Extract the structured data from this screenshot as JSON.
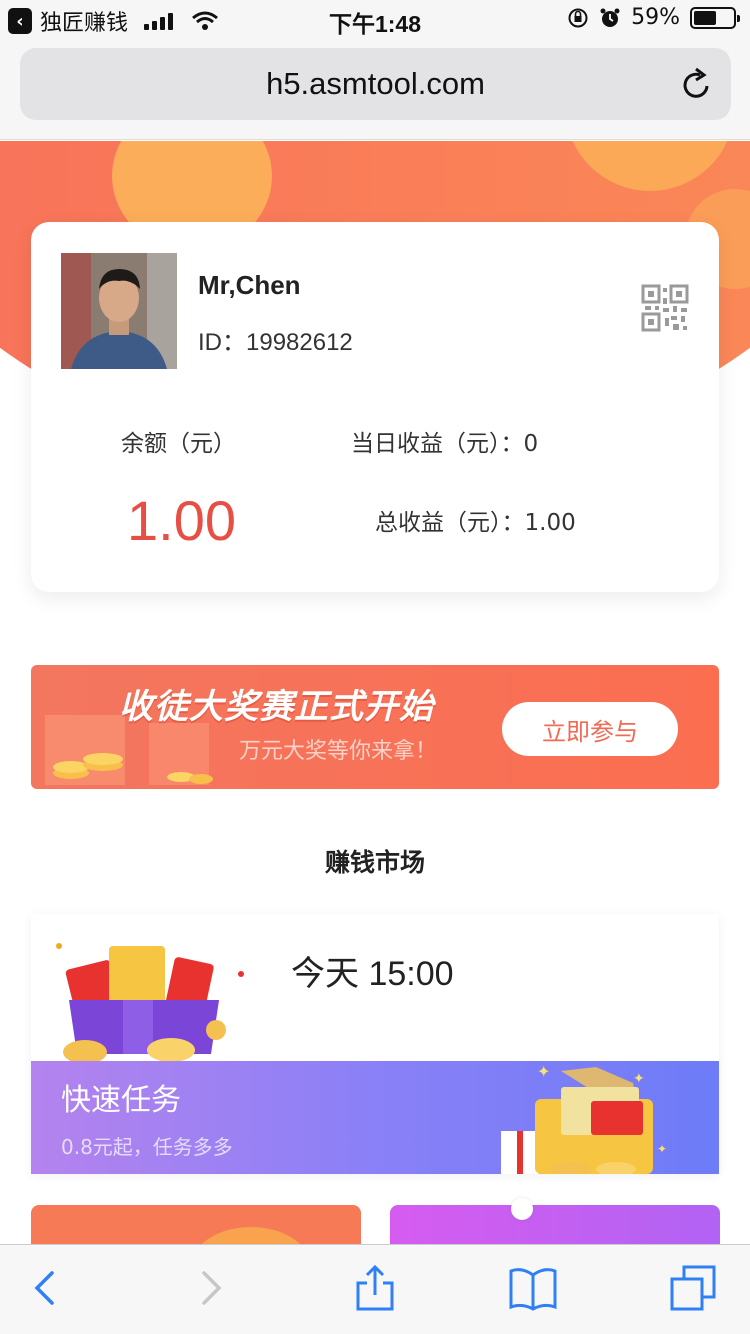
{
  "status_bar": {
    "back_app_label": "独匠赚钱",
    "time": "下午1:48",
    "battery": "59%",
    "battery_level": 0.59
  },
  "browser": {
    "url": "h5.asmtool.com"
  },
  "profile": {
    "name": "Mr,Chen",
    "id_text": "ID：19982612",
    "balance_label": "余额（元）",
    "balance_value": "1.00",
    "today_income": "当日收益（元）：0",
    "total_income": "总收益（元）：1.00"
  },
  "banner": {
    "title": "收徒大奖赛正式开始",
    "subtitle": "万元大奖等你来拿！",
    "button": "立即参与"
  },
  "market": {
    "section_title": "赚钱市场",
    "time": "今天 15:00",
    "task_name": "快速任务",
    "task_desc": "0.8元起，任务多多"
  },
  "colors": {
    "accent": "#f8705a",
    "balance": "#e74f45",
    "band_start": "#b483ee",
    "band_end": "#6d7cf7",
    "link_blue": "#2f7ff5"
  }
}
